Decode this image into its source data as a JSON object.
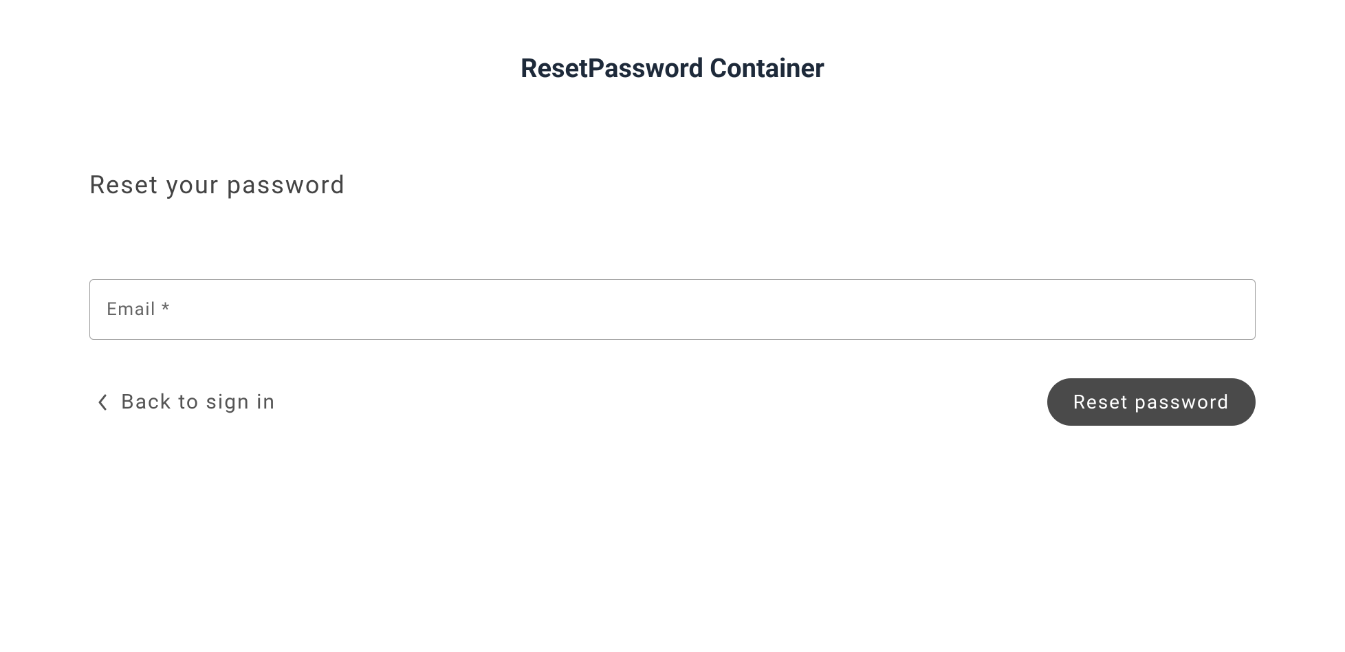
{
  "page": {
    "title": "ResetPassword Container"
  },
  "form": {
    "heading": "Reset your password",
    "email": {
      "placeholder": "Email *",
      "value": ""
    },
    "back_link_label": "Back to sign in",
    "submit_label": "Reset password"
  }
}
